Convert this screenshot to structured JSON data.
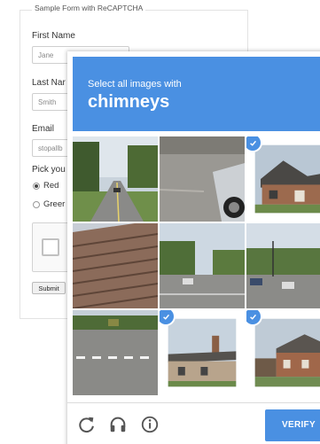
{
  "form": {
    "legend": "Sample Form with ReCAPTCHA",
    "first_name_label": "First Name",
    "first_name_value": "Jane",
    "last_name_label": "Last Nar",
    "last_name_value": "Smith",
    "email_label": "Email",
    "email_value": "stopallb",
    "pick_label": "Pick you",
    "options": [
      "Red",
      "Greer"
    ],
    "selected_option": "Red",
    "submit_label": "Submit"
  },
  "challenge": {
    "instruction": "Select all images with",
    "object": "chimneys",
    "header_color": "#4a90e2",
    "tiles": [
      {
        "scene": "road-trees",
        "selected": false
      },
      {
        "scene": "car-driveway",
        "selected": false
      },
      {
        "scene": "brick-house",
        "selected": true
      },
      {
        "scene": "roof-shingles",
        "selected": false
      },
      {
        "scene": "intersection-1",
        "selected": false
      },
      {
        "scene": "intersection-2",
        "selected": false
      },
      {
        "scene": "crosswalk",
        "selected": false
      },
      {
        "scene": "house-chimney",
        "selected": true
      },
      {
        "scene": "brick-house-2",
        "selected": true
      }
    ],
    "icons": [
      "reload-icon",
      "audio-headphones-icon",
      "info-icon"
    ],
    "verify_label": "VERIFY"
  }
}
